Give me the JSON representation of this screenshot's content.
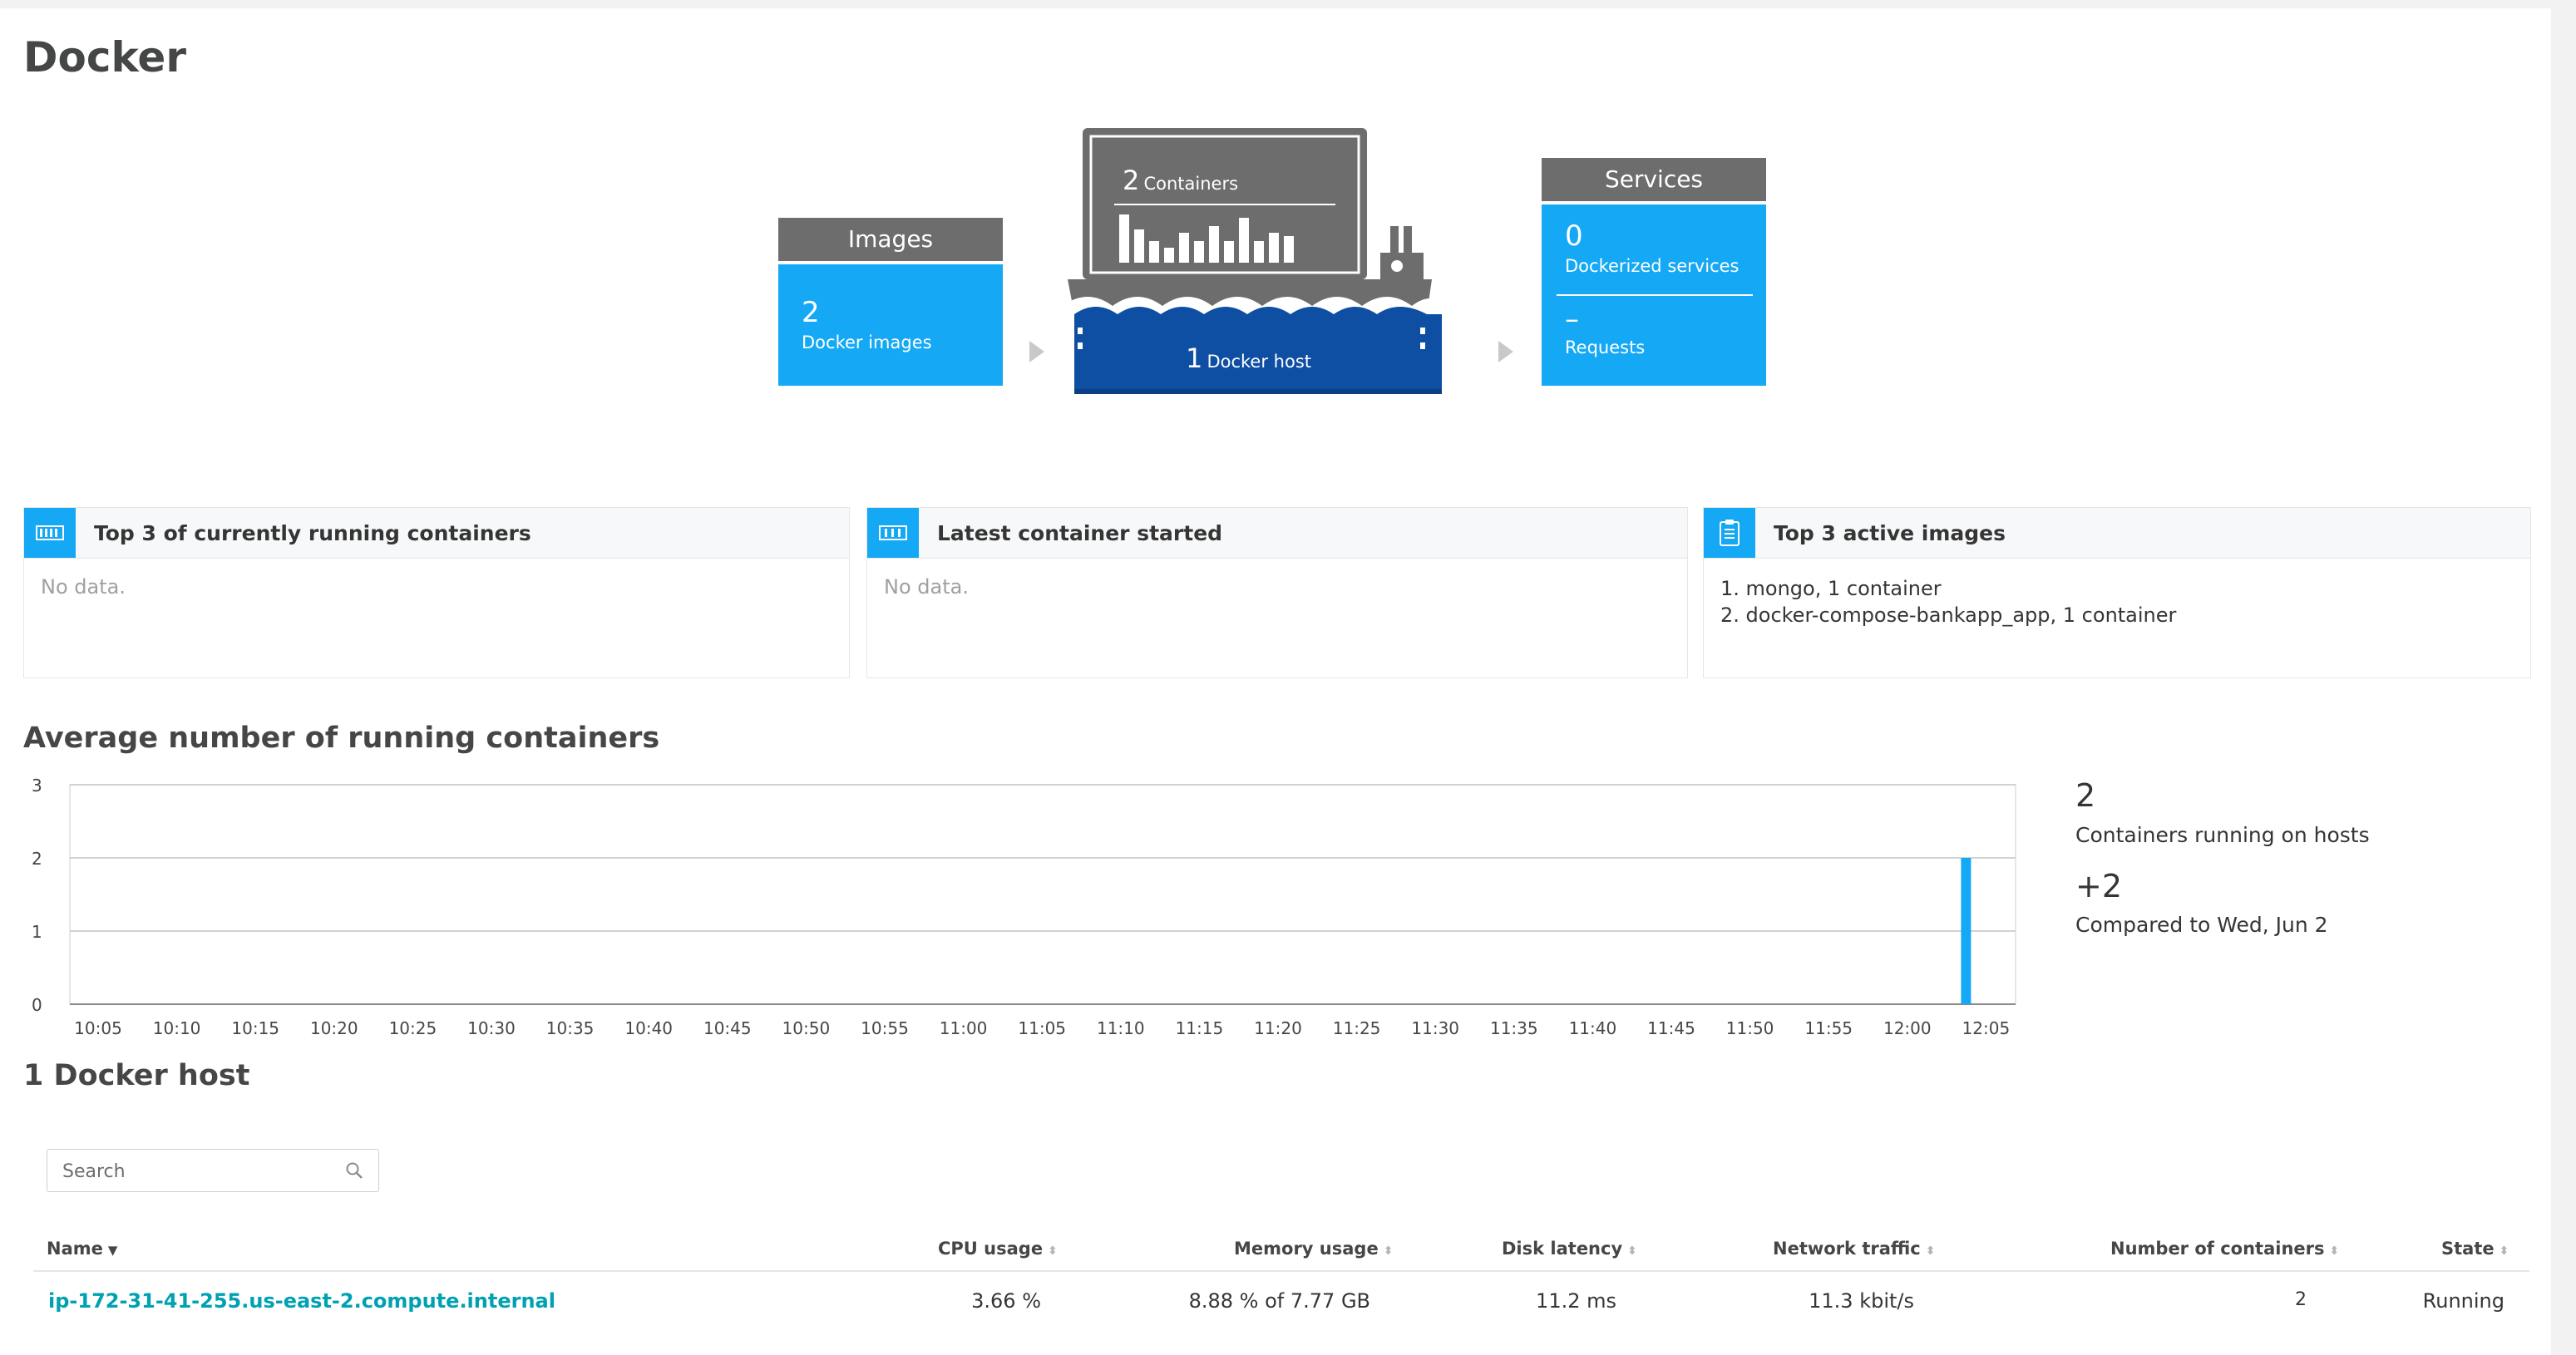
{
  "page": {
    "title": "Docker"
  },
  "overview": {
    "images": {
      "header": "Images",
      "count": "2",
      "label": "Docker images"
    },
    "ship": {
      "containers_count": "2",
      "containers_label": "Containers",
      "host_count": "1",
      "host_label": "Docker host"
    },
    "services": {
      "header": "Services",
      "count": "0",
      "label": "Dockerized services",
      "requests_value": "–",
      "requests_label": "Requests"
    }
  },
  "tiles": {
    "running": {
      "title": "Top 3 of currently running containers",
      "body": "No data.",
      "icon": "container-icon"
    },
    "latest": {
      "title": "Latest container started",
      "body": "No data.",
      "icon": "container-icon"
    },
    "images": {
      "title": "Top 3 active images",
      "icon": "clipboard-icon",
      "items": [
        "1. mongo, 1 container",
        "2. docker-compose-bankapp_app, 1 container"
      ]
    }
  },
  "chart_section": {
    "title": "Average number of running containers",
    "stat1": {
      "value": "2",
      "label": "Containers running on hosts"
    },
    "stat2": {
      "value": "+2",
      "label": "Compared to Wed, Jun 2"
    }
  },
  "chart_data": {
    "type": "bar",
    "categories": [
      "10:05",
      "10:10",
      "10:15",
      "10:20",
      "10:25",
      "10:30",
      "10:35",
      "10:40",
      "10:45",
      "10:50",
      "10:55",
      "11:00",
      "11:05",
      "11:10",
      "11:15",
      "11:20",
      "11:25",
      "11:30",
      "11:35",
      "11:40",
      "11:45",
      "11:50",
      "11:55",
      "12:00",
      "12:05"
    ],
    "y_ticks": [
      "0",
      "1",
      "2",
      "3"
    ],
    "ylim": [
      0,
      3
    ],
    "series": [
      {
        "values": [
          {
            "x": "12:05",
            "y": 2
          }
        ]
      }
    ],
    "grid": true,
    "bar_color": "#14a8f5"
  },
  "hosts_section": {
    "title": "1 Docker host",
    "search_placeholder": "Search",
    "columns": {
      "name": "Name",
      "cpu": "CPU usage",
      "memory": "Memory usage",
      "disk": "Disk latency",
      "network": "Network traffic",
      "containers": "Number of containers",
      "state": "State"
    },
    "rows": [
      {
        "name": "ip-172-31-41-255.us-east-2.compute.internal",
        "cpu": "3.66 %",
        "memory": "8.88 % of 7.77 GB",
        "disk": "11.2 ms",
        "network": "11.3 kbit/s",
        "containers": "2",
        "state": "Running"
      }
    ]
  },
  "colors": {
    "accent": "#14a8f5",
    "header_gray": "#6d6d6d",
    "host_blue": "#0e4ea3",
    "link": "#00a1b2"
  }
}
